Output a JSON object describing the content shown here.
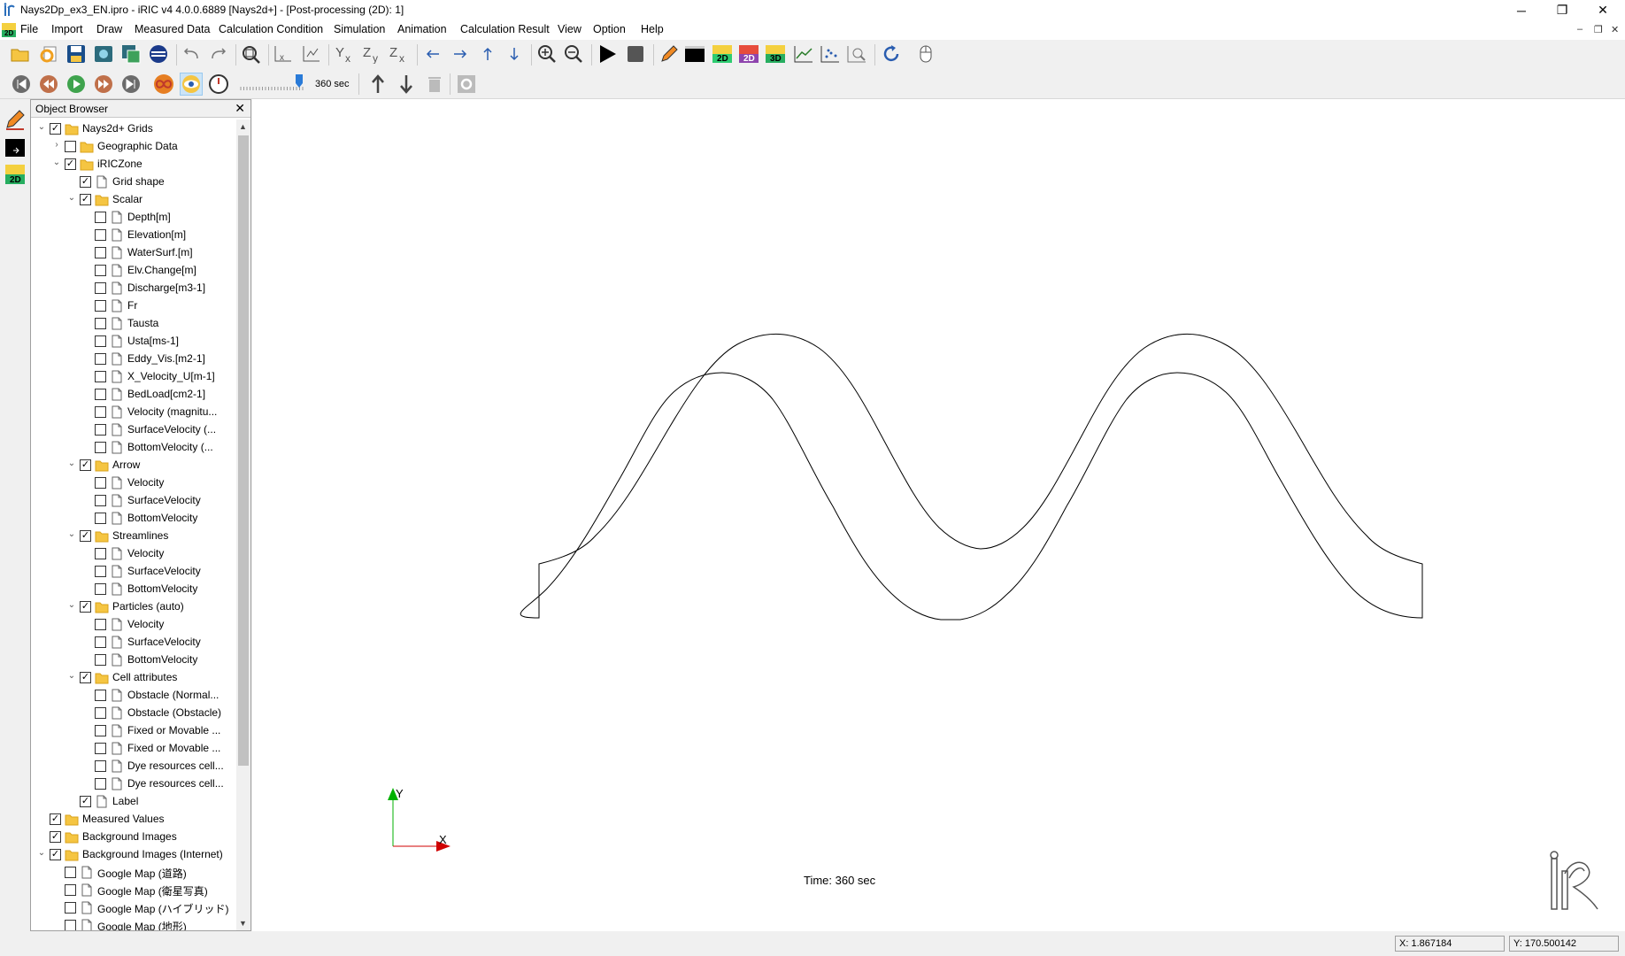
{
  "window": {
    "title": "Nays2Dp_ex3_EN.ipro - iRIC v4 4.0.0.6889 [Nays2d+] - [Post-processing (2D): 1]",
    "minimize": "─",
    "restore": "❐",
    "close": "✕"
  },
  "menu": {
    "items": [
      "File",
      "Import",
      "Draw",
      "Measured Data",
      "Calculation Condition",
      "Simulation",
      "Animation",
      "Calculation Result",
      "View",
      "Option",
      "Help"
    ],
    "mdi_minimize": "–",
    "mdi_restore": "❐",
    "mdi_close": "✕"
  },
  "animation": {
    "time_label": "360 sec",
    "slider_fraction": 1.0
  },
  "object_browser": {
    "title": "Object Browser",
    "close": "✕",
    "items": [
      {
        "label": "Nays2d+ Grids",
        "level": 0,
        "expander": "open",
        "checked": true,
        "icon": "folder"
      },
      {
        "label": "Geographic Data",
        "level": 1,
        "expander": "closed",
        "checked": false,
        "icon": "folder"
      },
      {
        "label": "iRICZone",
        "level": 1,
        "expander": "open",
        "checked": true,
        "icon": "folder"
      },
      {
        "label": "Grid shape",
        "level": 2,
        "expander": "none",
        "checked": true,
        "icon": "doc"
      },
      {
        "label": "Scalar",
        "level": 2,
        "expander": "open",
        "checked": true,
        "icon": "folder"
      },
      {
        "label": "Depth[m]",
        "level": 3,
        "expander": "none",
        "checked": false,
        "icon": "doc"
      },
      {
        "label": "Elevation[m]",
        "level": 3,
        "expander": "none",
        "checked": false,
        "icon": "doc"
      },
      {
        "label": "WaterSurf.[m]",
        "level": 3,
        "expander": "none",
        "checked": false,
        "icon": "doc"
      },
      {
        "label": "Elv.Change[m]",
        "level": 3,
        "expander": "none",
        "checked": false,
        "icon": "doc"
      },
      {
        "label": "Discharge[m3-1]",
        "level": 3,
        "expander": "none",
        "checked": false,
        "icon": "doc"
      },
      {
        "label": "Fr",
        "level": 3,
        "expander": "none",
        "checked": false,
        "icon": "doc"
      },
      {
        "label": "Tausta",
        "level": 3,
        "expander": "none",
        "checked": false,
        "icon": "doc"
      },
      {
        "label": "Usta[ms-1]",
        "level": 3,
        "expander": "none",
        "checked": false,
        "icon": "doc"
      },
      {
        "label": "Eddy_Vis.[m2-1]",
        "level": 3,
        "expander": "none",
        "checked": false,
        "icon": "doc"
      },
      {
        "label": "X_Velocity_U[m-1]",
        "level": 3,
        "expander": "none",
        "checked": false,
        "icon": "doc"
      },
      {
        "label": "BedLoad[cm2-1]",
        "level": 3,
        "expander": "none",
        "checked": false,
        "icon": "doc"
      },
      {
        "label": "Velocity (magnitu...",
        "level": 3,
        "expander": "none",
        "checked": false,
        "icon": "doc"
      },
      {
        "label": "SurfaceVelocity (...",
        "level": 3,
        "expander": "none",
        "checked": false,
        "icon": "doc"
      },
      {
        "label": "BottomVelocity (...",
        "level": 3,
        "expander": "none",
        "checked": false,
        "icon": "doc"
      },
      {
        "label": "Arrow",
        "level": 2,
        "expander": "open",
        "checked": true,
        "icon": "folder"
      },
      {
        "label": "Velocity",
        "level": 3,
        "expander": "none",
        "checked": false,
        "icon": "doc"
      },
      {
        "label": "SurfaceVelocity",
        "level": 3,
        "expander": "none",
        "checked": false,
        "icon": "doc"
      },
      {
        "label": "BottomVelocity",
        "level": 3,
        "expander": "none",
        "checked": false,
        "icon": "doc"
      },
      {
        "label": "Streamlines",
        "level": 2,
        "expander": "open",
        "checked": true,
        "icon": "folder"
      },
      {
        "label": "Velocity",
        "level": 3,
        "expander": "none",
        "checked": false,
        "icon": "doc"
      },
      {
        "label": "SurfaceVelocity",
        "level": 3,
        "expander": "none",
        "checked": false,
        "icon": "doc"
      },
      {
        "label": "BottomVelocity",
        "level": 3,
        "expander": "none",
        "checked": false,
        "icon": "doc"
      },
      {
        "label": "Particles (auto)",
        "level": 2,
        "expander": "open",
        "checked": true,
        "icon": "folder"
      },
      {
        "label": "Velocity",
        "level": 3,
        "expander": "none",
        "checked": false,
        "icon": "doc"
      },
      {
        "label": "SurfaceVelocity",
        "level": 3,
        "expander": "none",
        "checked": false,
        "icon": "doc"
      },
      {
        "label": "BottomVelocity",
        "level": 3,
        "expander": "none",
        "checked": false,
        "icon": "doc"
      },
      {
        "label": "Cell attributes",
        "level": 2,
        "expander": "open",
        "checked": true,
        "icon": "folder"
      },
      {
        "label": "Obstacle (Normal...",
        "level": 3,
        "expander": "none",
        "checked": false,
        "icon": "doc"
      },
      {
        "label": "Obstacle (Obstacle)",
        "level": 3,
        "expander": "none",
        "checked": false,
        "icon": "doc"
      },
      {
        "label": "Fixed or Movable ...",
        "level": 3,
        "expander": "none",
        "checked": false,
        "icon": "doc"
      },
      {
        "label": "Fixed or Movable ...",
        "level": 3,
        "expander": "none",
        "checked": false,
        "icon": "doc"
      },
      {
        "label": "Dye resources cell...",
        "level": 3,
        "expander": "none",
        "checked": false,
        "icon": "doc"
      },
      {
        "label": "Dye resources cell...",
        "level": 3,
        "expander": "none",
        "checked": false,
        "icon": "doc"
      },
      {
        "label": "Label",
        "level": 2,
        "expander": "none",
        "checked": true,
        "icon": "doc"
      },
      {
        "label": "Measured Values",
        "level": 0,
        "expander": "none",
        "checked": true,
        "icon": "folder"
      },
      {
        "label": "Background Images",
        "level": 0,
        "expander": "none",
        "checked": true,
        "icon": "folder"
      },
      {
        "label": "Background Images (Internet)",
        "level": 0,
        "expander": "open",
        "checked": true,
        "icon": "folder"
      },
      {
        "label": "Google Map (道路)",
        "level": 1,
        "expander": "none",
        "checked": false,
        "icon": "doc"
      },
      {
        "label": "Google Map (衛星写真)",
        "level": 1,
        "expander": "none",
        "checked": false,
        "icon": "doc"
      },
      {
        "label": "Google Map (ハイブリッド)",
        "level": 1,
        "expander": "none",
        "checked": false,
        "icon": "doc"
      },
      {
        "label": "Google Map (地形)",
        "level": 1,
        "expander": "none",
        "checked": false,
        "icon": "doc"
      }
    ]
  },
  "viewport": {
    "time_text": "Time: 360 sec",
    "axis_y_label": "Y",
    "axis_x_label": "X"
  },
  "statusbar": {
    "x_coord": "X: 1.867184",
    "y_coord": "Y: 170.500142"
  }
}
